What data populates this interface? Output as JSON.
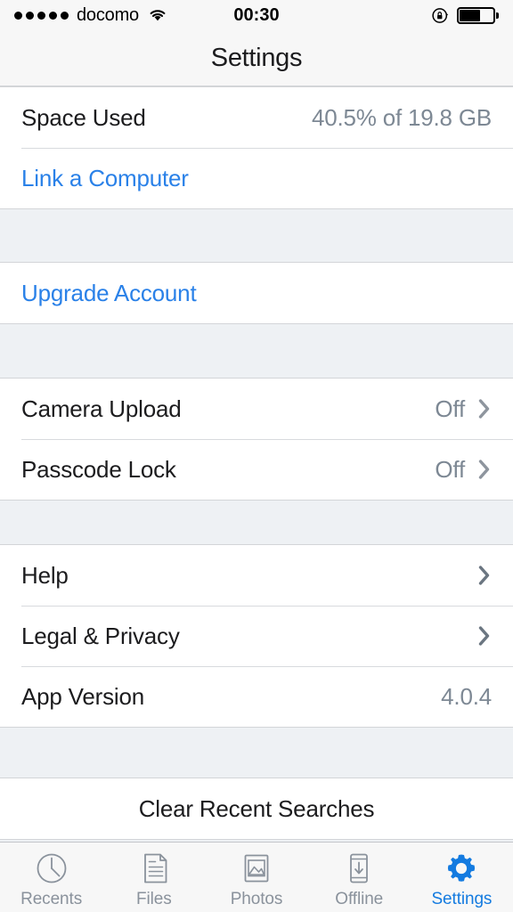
{
  "status_bar": {
    "carrier": "docomo",
    "signal_dots": 5,
    "wifi_icon": "wifi-icon",
    "time": "00:30",
    "rotation_lock_icon": "rotation-lock-icon",
    "battery_icon": "battery-icon",
    "battery_level_percent": 62
  },
  "nav": {
    "title": "Settings"
  },
  "sections": [
    {
      "rows": [
        {
          "label": "Space Used",
          "value": "40.5% of 19.8 GB",
          "chevron": false,
          "style": "default"
        },
        {
          "label": "Link a Computer",
          "value": "",
          "chevron": false,
          "style": "link"
        }
      ]
    },
    {
      "rows": [
        {
          "label": "Upgrade Account",
          "value": "",
          "chevron": false,
          "style": "link"
        }
      ]
    },
    {
      "rows": [
        {
          "label": "Camera Upload",
          "value": "Off",
          "chevron": true,
          "style": "default"
        },
        {
          "label": "Passcode Lock",
          "value": "Off",
          "chevron": true,
          "style": "default"
        }
      ]
    },
    {
      "rows": [
        {
          "label": "Help",
          "value": "",
          "chevron": true,
          "style": "default"
        },
        {
          "label": "Legal & Privacy",
          "value": "",
          "chevron": true,
          "style": "default"
        },
        {
          "label": "App Version",
          "value": "4.0.4",
          "chevron": false,
          "style": "default"
        }
      ]
    },
    {
      "rows": [
        {
          "label": "Clear Recent Searches",
          "value": "",
          "chevron": false,
          "style": "centered"
        }
      ]
    }
  ],
  "rows": {
    "space_used": {
      "label": "Space Used",
      "value": "40.5% of 19.8 GB"
    },
    "link_computer": {
      "label": "Link a Computer"
    },
    "upgrade_account": {
      "label": "Upgrade Account"
    },
    "camera_upload": {
      "label": "Camera Upload",
      "value": "Off"
    },
    "passcode_lock": {
      "label": "Passcode Lock",
      "value": "Off"
    },
    "help": {
      "label": "Help"
    },
    "legal_privacy": {
      "label": "Legal & Privacy"
    },
    "app_version": {
      "label": "App Version",
      "value": "4.0.4"
    },
    "clear_recent_searches": {
      "label": "Clear Recent Searches"
    }
  },
  "tab_bar": {
    "active": "Settings",
    "tabs": [
      {
        "label": "Recents",
        "icon": "clock-icon",
        "active": false
      },
      {
        "label": "Files",
        "icon": "document-icon",
        "active": false
      },
      {
        "label": "Photos",
        "icon": "photo-icon",
        "active": false
      },
      {
        "label": "Offline",
        "icon": "phone-download-icon",
        "active": false
      },
      {
        "label": "Settings",
        "icon": "gear-icon",
        "active": true
      }
    ]
  },
  "colors": {
    "link_blue": "#2a81e8",
    "active_tab_blue": "#147be0",
    "value_gray": "#7d8894",
    "chevron_gray": "#6b7681",
    "group_background": "#ffffff",
    "page_background": "#eef1f4",
    "bar_background": "#f7f7f7",
    "separator": "#d8dade",
    "label_text": "#1c1c1e",
    "tab_label_gray": "#8a929c"
  }
}
